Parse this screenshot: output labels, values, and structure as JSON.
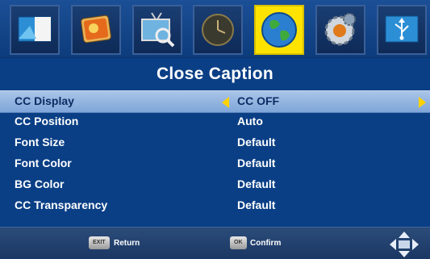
{
  "topbar": {
    "icons": [
      {
        "name": "picture-settings-icon"
      },
      {
        "name": "photo-icon"
      },
      {
        "name": "tv-search-icon"
      },
      {
        "name": "clock-icon"
      },
      {
        "name": "globe-icon",
        "selected": true
      },
      {
        "name": "gear-settings-icon"
      },
      {
        "name": "usb-icon"
      }
    ]
  },
  "page": {
    "title": "Close Caption"
  },
  "menu": {
    "rows": [
      {
        "label": "CC Display",
        "value": "CC OFF",
        "selected": true
      },
      {
        "label": "CC Position",
        "value": "Auto"
      },
      {
        "label": "Font Size",
        "value": "Default"
      },
      {
        "label": "Font Color",
        "value": "Default"
      },
      {
        "label": "BG Color",
        "value": "Default"
      },
      {
        "label": "CC Transparency",
        "value": "Default"
      }
    ]
  },
  "footer": {
    "exit_key": "EXIT",
    "return_label": "Return",
    "ok_key": "OK",
    "confirm_label": "Confirm"
  },
  "colors": {
    "background": "#0a3f86",
    "highlight_row": "#8fb2de",
    "selected_tile": "#ffe300",
    "arrow": "#ffd200"
  }
}
